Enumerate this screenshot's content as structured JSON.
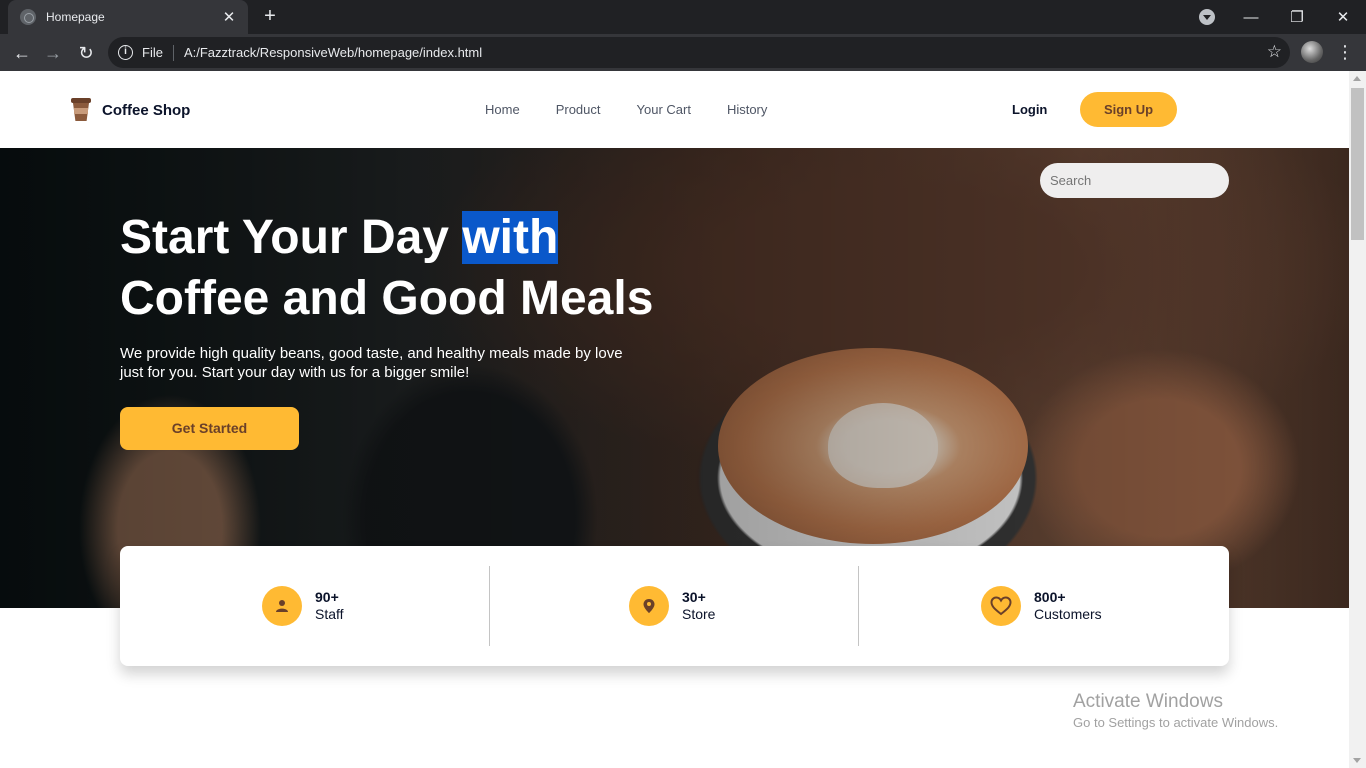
{
  "browser": {
    "tab_title": "Homepage",
    "tab_close": "✕",
    "new_tab": "+",
    "scheme_label": "File",
    "url": "A:/Fazztrack/ResponsiveWeb/homepage/index.html",
    "window_controls": {
      "minimize": "—",
      "restore": "❐",
      "close": "✕"
    }
  },
  "header": {
    "brand": "Coffee Shop",
    "nav": [
      "Home",
      "Product",
      "Your Cart",
      "History"
    ],
    "login": "Login",
    "signup": "Sign Up"
  },
  "hero": {
    "search_placeholder": "Search",
    "headline_part1": "Start Your Day ",
    "headline_highlight": "with",
    "headline_part2": "Coffee and Good Meals",
    "subtitle": "We provide high quality beans, good taste, and healthy meals made by love just for you. Start your day with us for a bigger smile!",
    "cta": "Get Started"
  },
  "stats": [
    {
      "value": "90+",
      "label": "Staff",
      "icon": "person-icon"
    },
    {
      "value": "30+",
      "label": "Store",
      "icon": "location-pin-icon"
    },
    {
      "value": "800+",
      "label": "Customers",
      "icon": "heart-icon"
    }
  ],
  "watermark": {
    "line1": "Activate Windows",
    "line2": "Go to Settings to activate Windows."
  },
  "colors": {
    "accent": "#ffba33",
    "brown": "#6a4029",
    "selection": "#0a58ca"
  }
}
